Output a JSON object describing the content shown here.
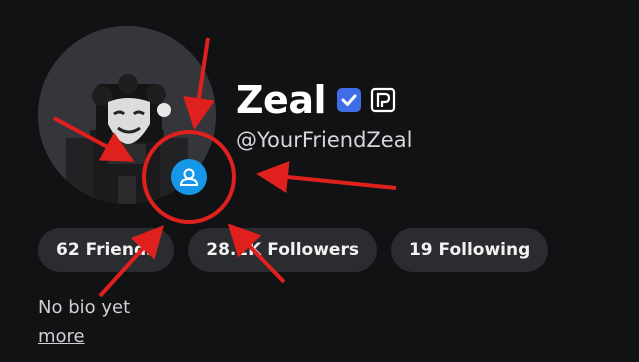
{
  "profile": {
    "display_name": "Zeal",
    "username": "@YourFriendZeal",
    "bio": "No bio yet",
    "more_label": "more"
  },
  "stats": {
    "friends": "62 Friends",
    "followers": "28.2K Followers",
    "following": "19 Following"
  },
  "icons": {
    "verified": "verified-badge-icon",
    "premium": "premium-icon",
    "avatar_badge": "person-icon"
  },
  "colors": {
    "background": "#111214",
    "pill": "#2a2c30",
    "verified": "#3e6de6",
    "badge": "#1697e8",
    "annotation": "#e0201c"
  }
}
